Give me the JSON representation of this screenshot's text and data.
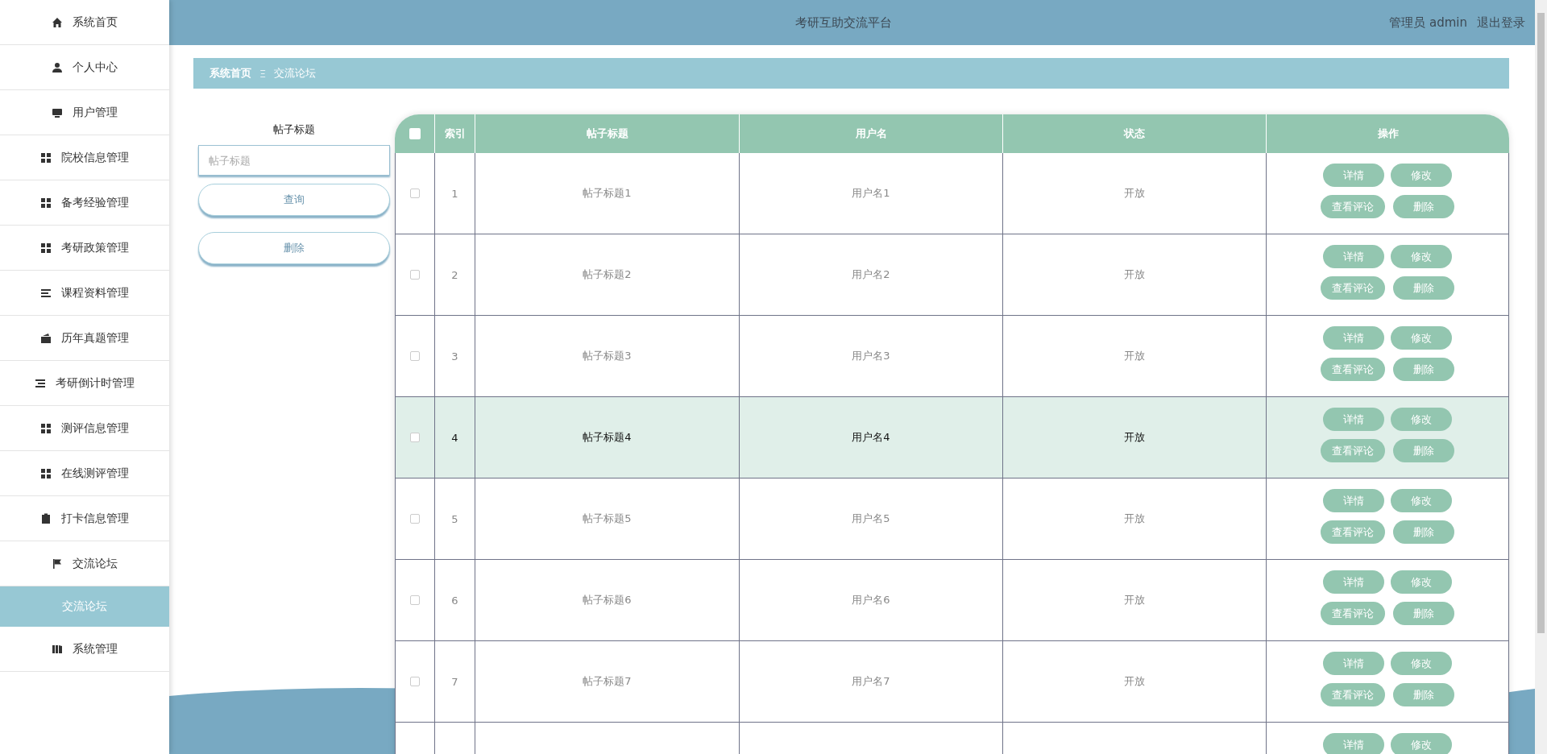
{
  "sidebar": {
    "items": [
      {
        "kind": "home",
        "label": "系统首页",
        "selected": false
      },
      {
        "kind": "user",
        "label": "个人中心",
        "selected": false
      },
      {
        "kind": "monitor",
        "label": "用户管理",
        "selected": false
      },
      {
        "kind": "grid",
        "label": "院校信息管理",
        "selected": false
      },
      {
        "kind": "grid",
        "label": "备考经验管理",
        "selected": false
      },
      {
        "kind": "grid",
        "label": "考研政策管理",
        "selected": false
      },
      {
        "kind": "lines",
        "label": "课程资料管理",
        "selected": false
      },
      {
        "kind": "wallet",
        "label": "历年真题管理",
        "selected": false
      },
      {
        "kind": "indent",
        "label": "考研倒计时管理",
        "selected": false
      },
      {
        "kind": "grid",
        "label": "测评信息管理",
        "selected": false
      },
      {
        "kind": "grid",
        "label": "在线测评管理",
        "selected": false
      },
      {
        "kind": "clipboard",
        "label": "打卡信息管理",
        "selected": false
      },
      {
        "kind": "flag",
        "label": "交流论坛",
        "selected": false,
        "children": [
          {
            "label": "交流论坛",
            "selected": true
          }
        ]
      },
      {
        "kind": "book",
        "label": "系统管理",
        "selected": false
      }
    ]
  },
  "header": {
    "title": "考研互助交流平台",
    "user": "管理员 admin",
    "logout": "退出登录"
  },
  "breadcrumb": {
    "home": "系统首页",
    "separator": "Ξ",
    "current": "交流论坛"
  },
  "search": {
    "label": "帖子标题",
    "placeholder": "帖子标题",
    "query_button": "查询",
    "delete_button": "删除"
  },
  "table": {
    "header_checked": false,
    "columns": [
      "索引",
      "帖子标题",
      "用户名",
      "状态",
      "操作"
    ],
    "rows": [
      {
        "index": "1",
        "title": "帖子标题1",
        "user": "用户名1",
        "status": "开放",
        "checked": false,
        "highlighted": false,
        "actions": [
          "详情",
          "修改",
          "查看评论",
          "删除"
        ]
      },
      {
        "index": "2",
        "title": "帖子标题2",
        "user": "用户名2",
        "status": "开放",
        "checked": false,
        "highlighted": false,
        "actions": [
          "详情",
          "修改",
          "查看评论",
          "删除"
        ]
      },
      {
        "index": "3",
        "title": "帖子标题3",
        "user": "用户名3",
        "status": "开放",
        "checked": false,
        "highlighted": false,
        "actions": [
          "详情",
          "修改",
          "查看评论",
          "删除"
        ]
      },
      {
        "index": "4",
        "title": "帖子标题4",
        "user": "用户名4",
        "status": "开放",
        "checked": false,
        "highlighted": true,
        "actions": [
          "详情",
          "修改",
          "查看评论",
          "删除"
        ]
      },
      {
        "index": "5",
        "title": "帖子标题5",
        "user": "用户名5",
        "status": "开放",
        "checked": false,
        "highlighted": false,
        "actions": [
          "详情",
          "修改",
          "查看评论",
          "删除"
        ]
      },
      {
        "index": "6",
        "title": "帖子标题6",
        "user": "用户名6",
        "status": "开放",
        "checked": false,
        "highlighted": false,
        "actions": [
          "详情",
          "修改",
          "查看评论",
          "删除"
        ]
      },
      {
        "index": "7",
        "title": "帖子标题7",
        "user": "用户名7",
        "status": "开放",
        "checked": false,
        "highlighted": false,
        "actions": [
          "详情",
          "修改",
          "查看评论",
          "删除"
        ]
      },
      {
        "actions": [
          "详情",
          "修改"
        ]
      }
    ]
  }
}
